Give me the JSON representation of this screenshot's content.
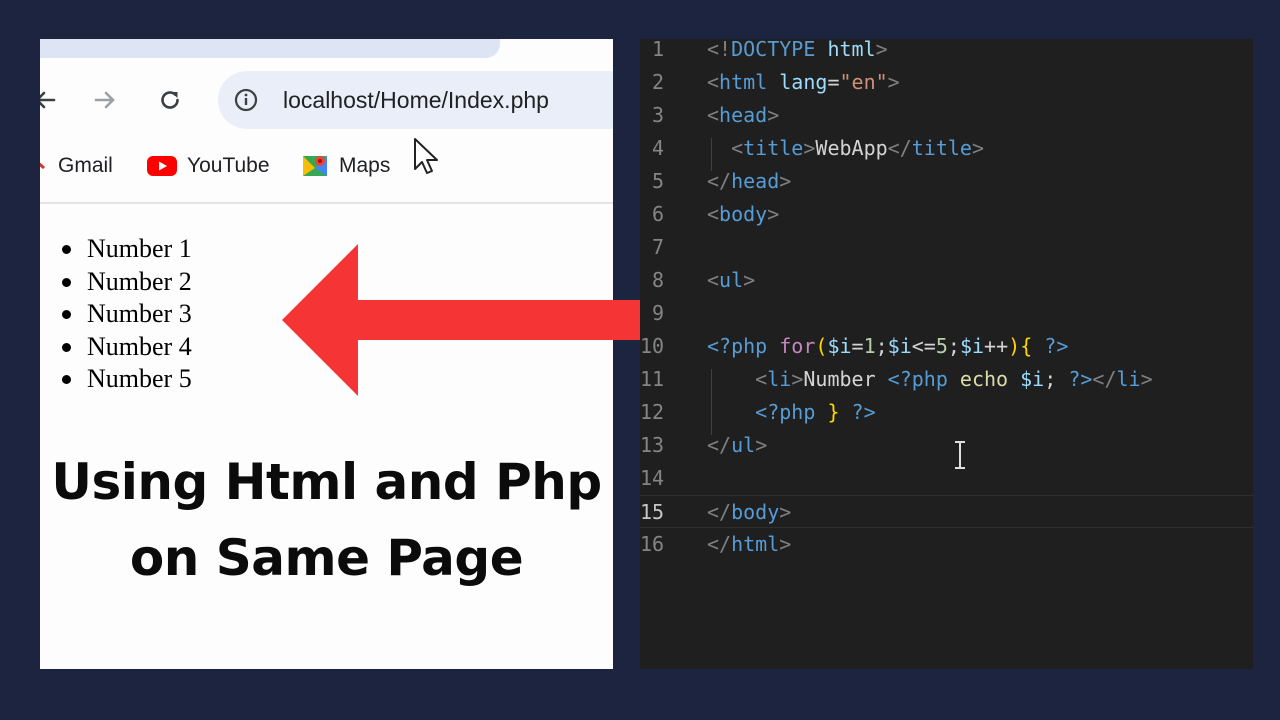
{
  "browser": {
    "url": "localhost/Home/Index.php",
    "bookmarks": [
      {
        "icon": "gmail-icon",
        "label": "Gmail"
      },
      {
        "icon": "youtube-icon",
        "label": "YouTube"
      },
      {
        "icon": "maps-icon",
        "label": "Maps"
      }
    ],
    "list_items": [
      "Number 1",
      "Number 2",
      "Number 3",
      "Number 4",
      "Number 5"
    ]
  },
  "caption": {
    "line1": "Using Html and Php",
    "line2": "on Same Page"
  },
  "editor": {
    "active_line": 15,
    "lines": [
      {
        "num": "1",
        "tokens": [
          [
            "t-tag",
            "<!"
          ],
          [
            "t-el",
            "DOCTYPE"
          ],
          [
            "t-txt",
            " "
          ],
          [
            "t-attr",
            "html"
          ],
          [
            "t-tag",
            ">"
          ]
        ]
      },
      {
        "num": "2",
        "tokens": [
          [
            "t-tag",
            "<"
          ],
          [
            "t-el",
            "html"
          ],
          [
            "t-txt",
            " "
          ],
          [
            "t-attr",
            "lang"
          ],
          [
            "t-op",
            "="
          ],
          [
            "t-str",
            "\"en\""
          ],
          [
            "t-tag",
            ">"
          ]
        ]
      },
      {
        "num": "3",
        "tokens": [
          [
            "t-tag",
            "<"
          ],
          [
            "t-el",
            "head"
          ],
          [
            "t-tag",
            ">"
          ]
        ]
      },
      {
        "num": "4",
        "tokens": [
          [
            "t-txt",
            "  "
          ],
          [
            "t-tag",
            "<"
          ],
          [
            "t-el",
            "title"
          ],
          [
            "t-tag",
            ">"
          ],
          [
            "t-txt",
            "WebApp"
          ],
          [
            "t-tag",
            "</"
          ],
          [
            "t-el",
            "title"
          ],
          [
            "t-tag",
            ">"
          ]
        ]
      },
      {
        "num": "5",
        "tokens": [
          [
            "t-tag",
            "</"
          ],
          [
            "t-el",
            "head"
          ],
          [
            "t-tag",
            ">"
          ]
        ]
      },
      {
        "num": "6",
        "tokens": [
          [
            "t-tag",
            "<"
          ],
          [
            "t-el",
            "body"
          ],
          [
            "t-tag",
            ">"
          ]
        ]
      },
      {
        "num": "7",
        "tokens": []
      },
      {
        "num": "8",
        "tokens": [
          [
            "t-tag",
            "<"
          ],
          [
            "t-el",
            "ul"
          ],
          [
            "t-tag",
            ">"
          ]
        ]
      },
      {
        "num": "9",
        "tokens": []
      },
      {
        "num": "10",
        "tokens": [
          [
            "t-php",
            "<?php"
          ],
          [
            "t-txt",
            " "
          ],
          [
            "t-kw",
            "for"
          ],
          [
            "t-br",
            "("
          ],
          [
            "t-var",
            "$i"
          ],
          [
            "t-op",
            "="
          ],
          [
            "t-num",
            "1"
          ],
          [
            "t-op",
            ";"
          ],
          [
            "t-var",
            "$i"
          ],
          [
            "t-op",
            "<="
          ],
          [
            "t-num",
            "5"
          ],
          [
            "t-op",
            ";"
          ],
          [
            "t-var",
            "$i"
          ],
          [
            "t-op",
            "++"
          ],
          [
            "t-br",
            ")"
          ],
          [
            "t-br",
            "{"
          ],
          [
            "t-txt",
            " "
          ],
          [
            "t-php",
            "?>"
          ]
        ]
      },
      {
        "num": "11",
        "tokens": [
          [
            "t-txt",
            "    "
          ],
          [
            "t-tag",
            "<"
          ],
          [
            "t-el",
            "li"
          ],
          [
            "t-tag",
            ">"
          ],
          [
            "t-txt",
            "Number "
          ],
          [
            "t-php",
            "<?php"
          ],
          [
            "t-txt",
            " "
          ],
          [
            "t-fn",
            "echo"
          ],
          [
            "t-txt",
            " "
          ],
          [
            "t-var",
            "$i"
          ],
          [
            "t-op",
            ";"
          ],
          [
            "t-txt",
            " "
          ],
          [
            "t-php",
            "?>"
          ],
          [
            "t-tag",
            "</"
          ],
          [
            "t-el",
            "li"
          ],
          [
            "t-tag",
            ">"
          ]
        ]
      },
      {
        "num": "12",
        "tokens": [
          [
            "t-txt",
            "    "
          ],
          [
            "t-php",
            "<?php"
          ],
          [
            "t-txt",
            " "
          ],
          [
            "t-br",
            "}"
          ],
          [
            "t-txt",
            " "
          ],
          [
            "t-php",
            "?>"
          ]
        ]
      },
      {
        "num": "13",
        "tokens": [
          [
            "t-tag",
            "</"
          ],
          [
            "t-el",
            "ul"
          ],
          [
            "t-tag",
            ">"
          ]
        ]
      },
      {
        "num": "14",
        "tokens": []
      },
      {
        "num": "15",
        "tokens": [
          [
            "t-tag",
            "</"
          ],
          [
            "t-el",
            "body"
          ],
          [
            "t-tag",
            ">"
          ]
        ]
      },
      {
        "num": "16",
        "tokens": [
          [
            "t-tag",
            "</"
          ],
          [
            "t-el",
            "html"
          ],
          [
            "t-tag",
            ">"
          ]
        ]
      }
    ]
  },
  "colors": {
    "background": "#1c2440",
    "arrow": "#f53535",
    "editor_bg": "#1f1f1f"
  }
}
